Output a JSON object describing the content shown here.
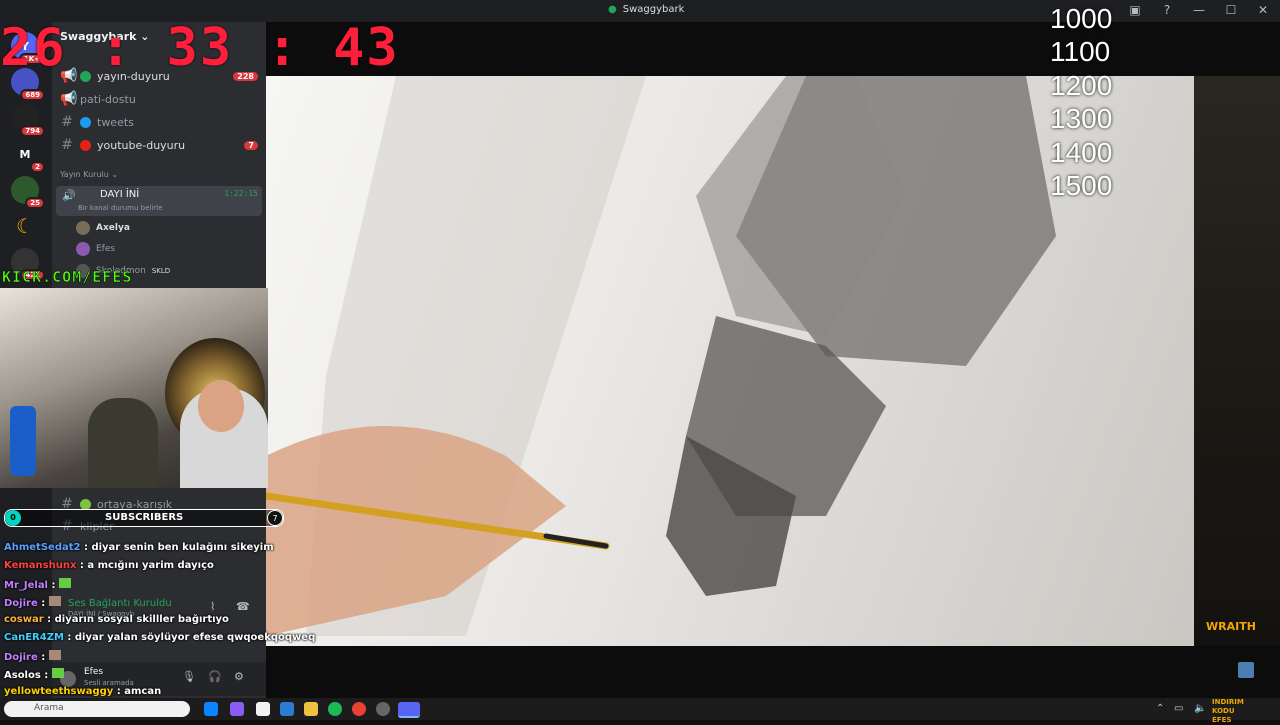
{
  "window": {
    "title": "Swaggybark"
  },
  "overlay": {
    "timer": "26 : 33 : 43",
    "counter_lines": [
      "1000",
      "1100",
      "1200",
      "1300",
      "1400",
      "1500"
    ],
    "kick_text": "KICK.COM/EFES",
    "subs_label": "SUBSCRIBERS",
    "subs_current": "0",
    "subs_goal": "7",
    "wraith_text": "WRAITH"
  },
  "server": {
    "name": "Swaggybark"
  },
  "rail_badges": [
    "1K+",
    "689",
    "794",
    "2",
    "25",
    "422"
  ],
  "channels": [
    {
      "name": "yayın-duyuru",
      "dot": "#23a559",
      "badge": "228"
    },
    {
      "name": "pati-dostu",
      "dot": "",
      "badge": ""
    },
    {
      "name": "tweets",
      "dot": "#1d9bf0",
      "badge": ""
    },
    {
      "name": "youtube-duyuru",
      "dot": "#e62117",
      "badge": "7"
    }
  ],
  "voice_category": "Yayın Kurulu",
  "voice_channel": {
    "name": "DAYI İNİ",
    "time": "1:22:15",
    "status": "Bir kanal durumu belirle"
  },
  "voice_users": [
    "Axelya",
    "Efes",
    "Skoledmon"
  ],
  "voice_user_tag": "SKLD",
  "lower_channels": [
    "ortaya-karışık",
    "klipler"
  ],
  "connection": {
    "label": "Ses Bağlantı Kuruldu",
    "sub": "DAYI İNİ / Swaggyb"
  },
  "user": {
    "name": "Efes",
    "status": "Sesli aramada"
  },
  "chat": [
    {
      "user": "AhmetSedat2",
      "color": "#5aa0ff",
      "text": ": diyar senin ben kulağını sikeyim"
    },
    {
      "user": "Kemanshunx",
      "color": "#ff4040",
      "text": ": a mcığını yarim dayıço"
    },
    {
      "user": "Mr_Jelal",
      "color": "#c080ff",
      "text": ":"
    },
    {
      "user": "Dojire",
      "color": "#c080ff",
      "text": ":"
    },
    {
      "user": "coswar",
      "color": "#ffb040",
      "text": ": diyarın sosyal skilller bağırtıyo"
    },
    {
      "user": "CanER4ZM",
      "color": "#40d0ff",
      "text": ": diyar yalan söylüyor efese qwqoekqoqweq"
    },
    {
      "user": "Dojire",
      "color": "#c080ff",
      "text": ":"
    },
    {
      "user": "Asolos",
      "color": "#ffffff",
      "text": ":"
    },
    {
      "user": "yellowteethswaggy",
      "color": "#ffd000",
      "text": ": amcan"
    }
  ],
  "taskbar": {
    "search_text": "Arama",
    "tray_text": "INDIRIM KODU EFES"
  }
}
